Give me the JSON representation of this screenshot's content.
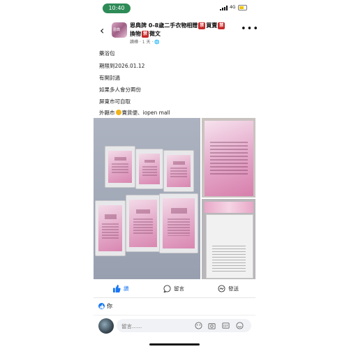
{
  "status_bar": {
    "time": "10:40",
    "network": "4G"
  },
  "header": {
    "title_part1": "恩典牌 0-8歲二手衣物相贈",
    "title_badge1": "禁",
    "title_part2": "買賣",
    "title_badge2": "禁",
    "title_part3": "換物",
    "title_badge3": "禁",
    "title_part4": "徵文",
    "meta": "讀樺 · 1 天 · 🌐"
  },
  "post_lines": [
    "藥浴包",
    "期限到2026.01.12",
    "有開封過",
    "如果多人會分兩份",
    "屏東市可自取"
  ],
  "post_last_line": {
    "prefix": "外縣市",
    "suffix": "賣貨便、iopen mall"
  },
  "actions": {
    "like": "讚",
    "comment": "留言",
    "share": "發送"
  },
  "reactions": {
    "text": "你"
  },
  "comment_bar": {
    "placeholder": "留言......"
  },
  "colors": {
    "accent": "#1877f2",
    "time_pill": "#2e8b57",
    "no_badge": "#c62828"
  },
  "icons": [
    "back-icon",
    "more-icon",
    "like-icon",
    "comment-icon",
    "share-icon",
    "sticker-icon",
    "camera-icon",
    "gif-icon",
    "emoji-icon"
  ]
}
